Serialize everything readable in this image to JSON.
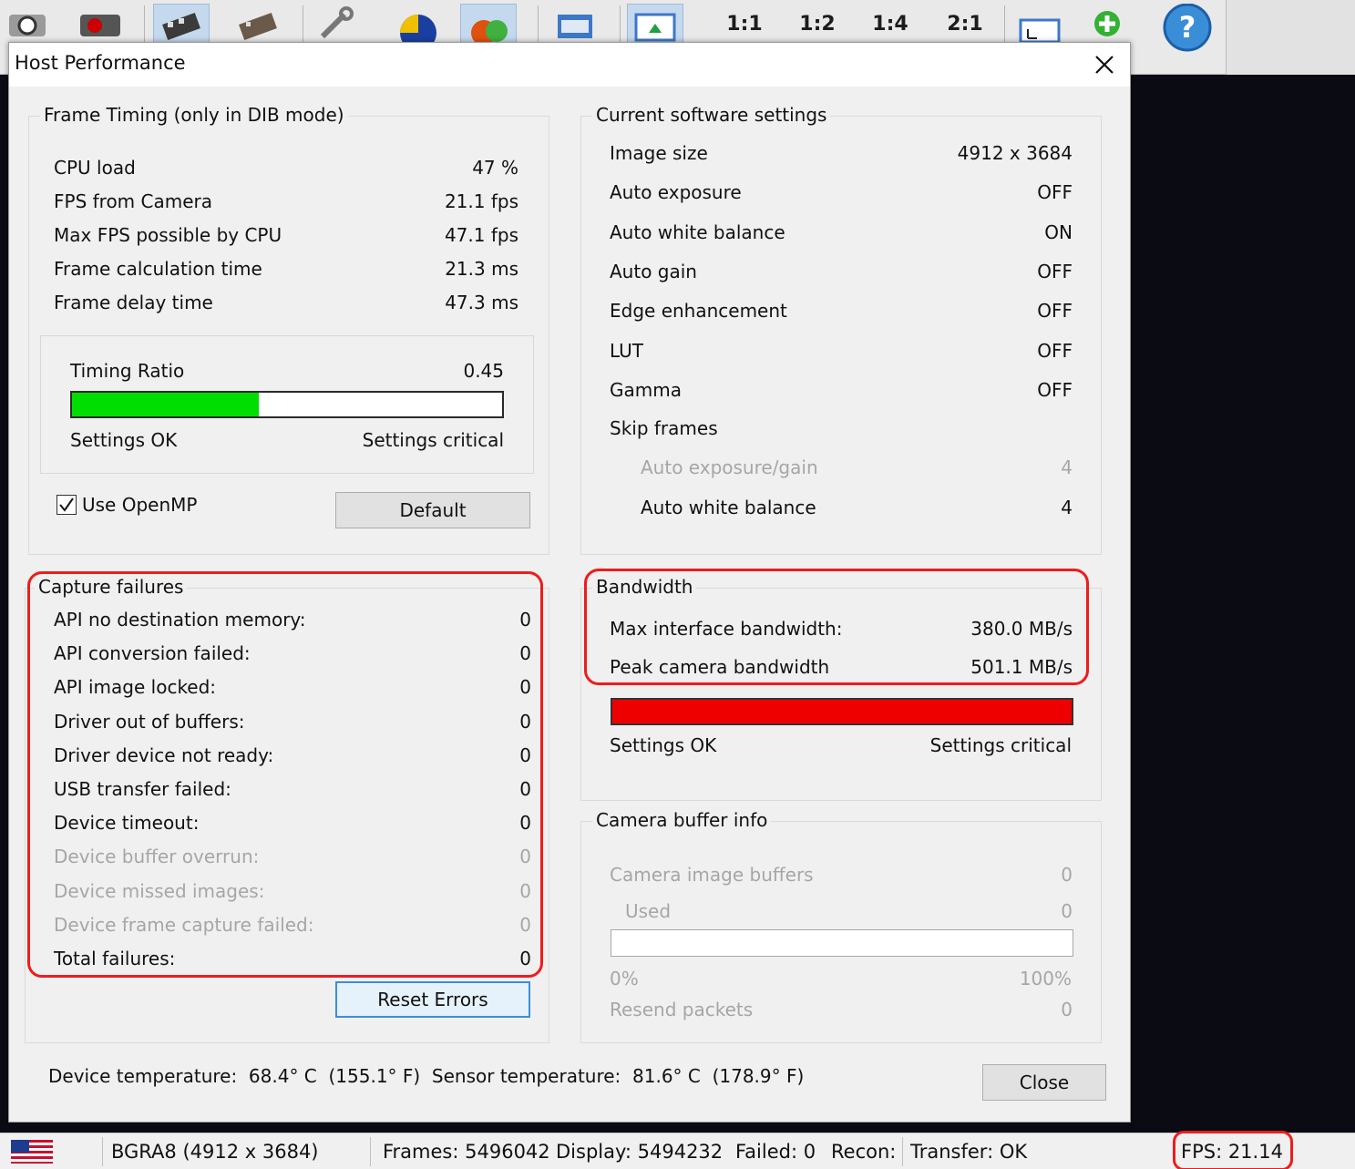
{
  "toolbar": {
    "zoom_1_1": "1:1",
    "zoom_1_2": "1:2",
    "zoom_1_4": "1:4",
    "zoom_2_1": "2:1",
    "help_icon": "?"
  },
  "dialog": {
    "title": "Host Performance",
    "frame_timing": {
      "legend": "Frame Timing (only in DIB mode)",
      "rows": [
        {
          "label": "CPU load",
          "value": "47 %"
        },
        {
          "label": "FPS from Camera",
          "value": "21.1 fps"
        },
        {
          "label": "Max FPS possible by CPU",
          "value": "47.1 fps"
        },
        {
          "label": "Frame calculation time",
          "value": "21.3 ms"
        },
        {
          "label": "Frame delay time",
          "value": "47.3 ms"
        }
      ],
      "timing_ratio_label": "Timing Ratio",
      "timing_ratio_value": "0.45",
      "timing_ratio_fill": 0.435,
      "settings_ok": "Settings OK",
      "settings_critical": "Settings critical",
      "use_openmp_label": "Use OpenMP",
      "use_openmp_checked": true,
      "default_button": "Default"
    },
    "software_settings": {
      "legend": "Current software settings",
      "rows": [
        {
          "label": "Image size",
          "value": "4912 x 3684"
        },
        {
          "label": "Auto exposure",
          "value": "OFF"
        },
        {
          "label": "Auto white balance",
          "value": "ON"
        },
        {
          "label": "Auto gain",
          "value": "OFF"
        },
        {
          "label": "Edge enhancement",
          "value": "OFF"
        },
        {
          "label": "LUT",
          "value": "OFF"
        },
        {
          "label": "Gamma",
          "value": "OFF"
        }
      ],
      "skip_frames_label": "Skip frames",
      "skip_rows": [
        {
          "label": "Auto exposure/gain",
          "value": "4",
          "disabled": true
        },
        {
          "label": "Auto white balance",
          "value": "4",
          "disabled": false
        }
      ]
    },
    "capture_failures": {
      "legend": "Capture failures",
      "rows": [
        {
          "label": "API no destination memory:",
          "value": "0"
        },
        {
          "label": "API conversion failed:",
          "value": "0"
        },
        {
          "label": "API image locked:",
          "value": "0"
        },
        {
          "label": "Driver out of buffers:",
          "value": "0"
        },
        {
          "label": "Driver device not ready:",
          "value": "0"
        },
        {
          "label": "USB transfer failed:",
          "value": "0"
        },
        {
          "label": "Device timeout:",
          "value": "0"
        },
        {
          "label": "Device buffer overrun:",
          "value": "0"
        },
        {
          "label": "Device missed images:",
          "value": "0"
        },
        {
          "label": "Device frame capture failed:",
          "value": "0"
        },
        {
          "label": "Total failures:",
          "value": "0"
        }
      ],
      "reset_button": "Reset Errors"
    },
    "bandwidth": {
      "legend": "Bandwidth",
      "rows": [
        {
          "label": "Max interface bandwidth:",
          "value": "380.0 MB/s"
        },
        {
          "label": "Peak camera bandwidth",
          "value": "501.1 MB/s"
        }
      ],
      "bar_fill": 1.0,
      "bar_color": "#ee0000",
      "settings_ok": "Settings OK",
      "settings_critical": "Settings critical"
    },
    "camera_buffer": {
      "legend": "Camera buffer info",
      "image_buffers_label": "Camera image buffers",
      "image_buffers_value": "0",
      "used_label": "Used",
      "used_value": "0",
      "bar_fill": 0.0,
      "min_label": "0%",
      "max_label": "100%",
      "resend_label": "Resend packets",
      "resend_value": "0"
    },
    "temperature_text": "Device temperature:  68.4° C  (155.1° F)  Sensor temperature:  81.6° C  (178.9° F)",
    "close_button": "Close"
  },
  "statusbar": {
    "format": "BGRA8 (4912 x 3684)",
    "frames": "Frames: 5496042",
    "display": "Display: 5494232",
    "failed": "Failed: 0",
    "recon": "Recon:",
    "transfer": "Transfer: OK",
    "fps": "FPS: 21.14"
  },
  "colors": {
    "ok_green": "#00dd00",
    "critical_red": "#ee0000",
    "highlight_red": "#ee1c1c"
  }
}
